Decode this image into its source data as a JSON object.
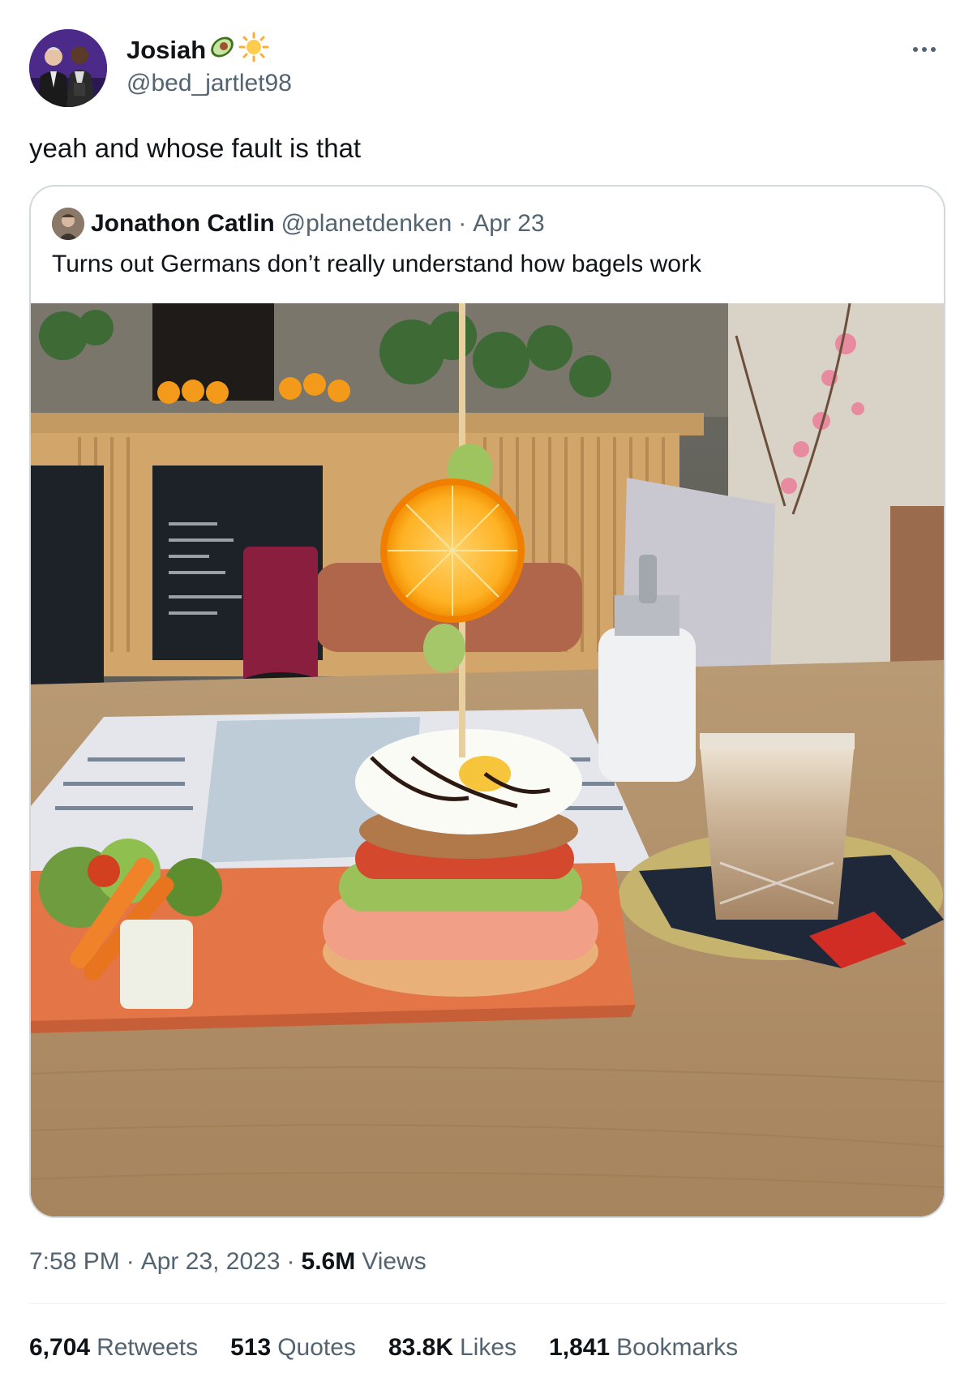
{
  "author": {
    "display_name": "Josiah",
    "emoji_1": "avocado-emoji",
    "emoji_2": "sun-emoji",
    "handle": "@bed_jartlet98"
  },
  "tweet": {
    "text": "yeah and whose fault is that"
  },
  "quoted_tweet": {
    "display_name": "Jonathon Catlin",
    "handle": "@planetdenken",
    "separator": "·",
    "date": "Apr 23",
    "text": "Turns out Germans don’t really understand how bagels work"
  },
  "meta": {
    "time": "7:58 PM",
    "separator_1": "·",
    "date": "Apr 23, 2023",
    "separator_2": "·",
    "views_count": "5.6M",
    "views_label": "Views"
  },
  "stats": {
    "retweets_count": "6,704",
    "retweets_label": "Retweets",
    "quotes_count": "513",
    "quotes_label": "Quotes",
    "likes_count": "83.8K",
    "likes_label": "Likes",
    "bookmarks_count": "1,841",
    "bookmarks_label": "Bookmarks"
  },
  "icons": {
    "more": "more-icon"
  }
}
